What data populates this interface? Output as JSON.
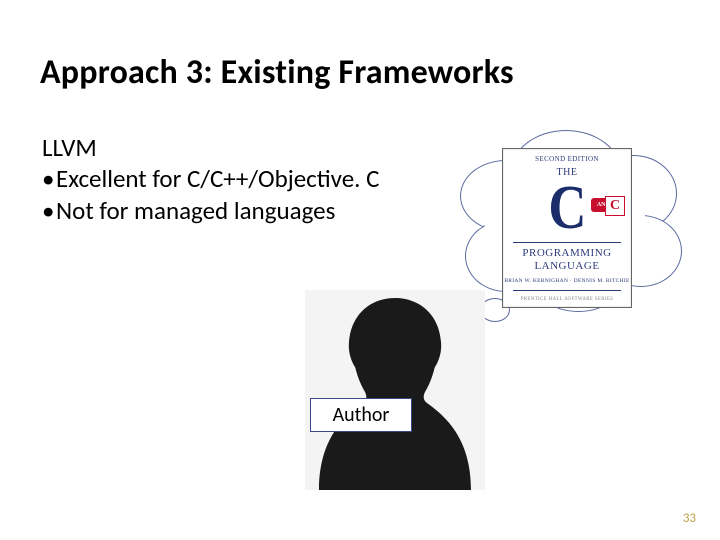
{
  "title": "Approach 3: Existing Frameworks",
  "body": {
    "heading": "LLVM",
    "bullets": [
      "Excellent for C/C++/Objective. C",
      "Not for managed languages"
    ]
  },
  "thought_book": {
    "edition": "SECOND EDITION",
    "the": "THE",
    "big_letter": "C",
    "ansi_label": "ANSI",
    "ansi_letter": "C",
    "line1": "PROGRAMMING",
    "line2": "LANGUAGE",
    "authors": "BRIAN W. KERNIGHAN · DENNIS M. RITCHIE",
    "publisher": "PRENTICE HALL SOFTWARE SERIES"
  },
  "author_label": "Author",
  "page_number": "33"
}
